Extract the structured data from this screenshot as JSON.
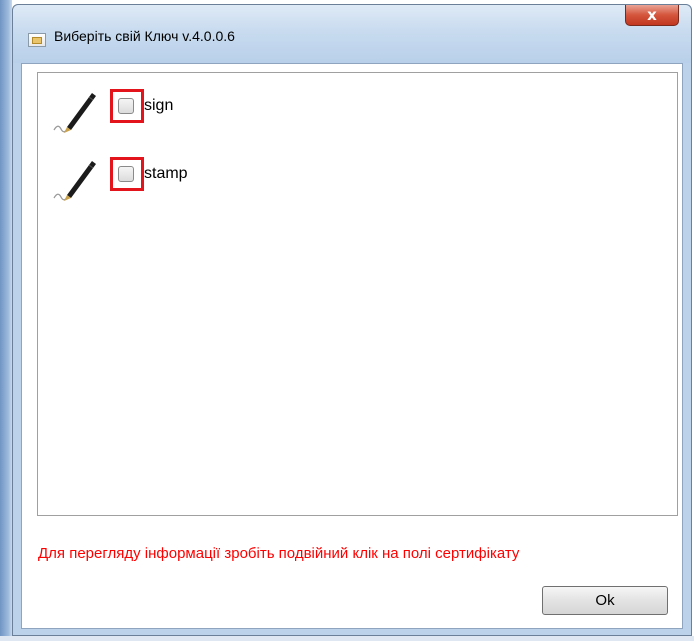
{
  "window": {
    "title": "Виберіть свій Ключ v.4.0.0.6",
    "close_label": "x",
    "icon": "app-window-icon"
  },
  "keys": [
    {
      "label": "sign",
      "checked": false,
      "icon": "pen-signature-icon"
    },
    {
      "label": "stamp",
      "checked": false,
      "icon": "pen-signature-icon"
    }
  ],
  "hint": "Для перегляду інформації зробіть подвійний клік на полі сертифікату",
  "ok_label": "Ok",
  "colors": {
    "highlight": "#e3141c",
    "hint": "#ff0000",
    "titlebar": "#c8dbef",
    "close": "#d4543c"
  }
}
